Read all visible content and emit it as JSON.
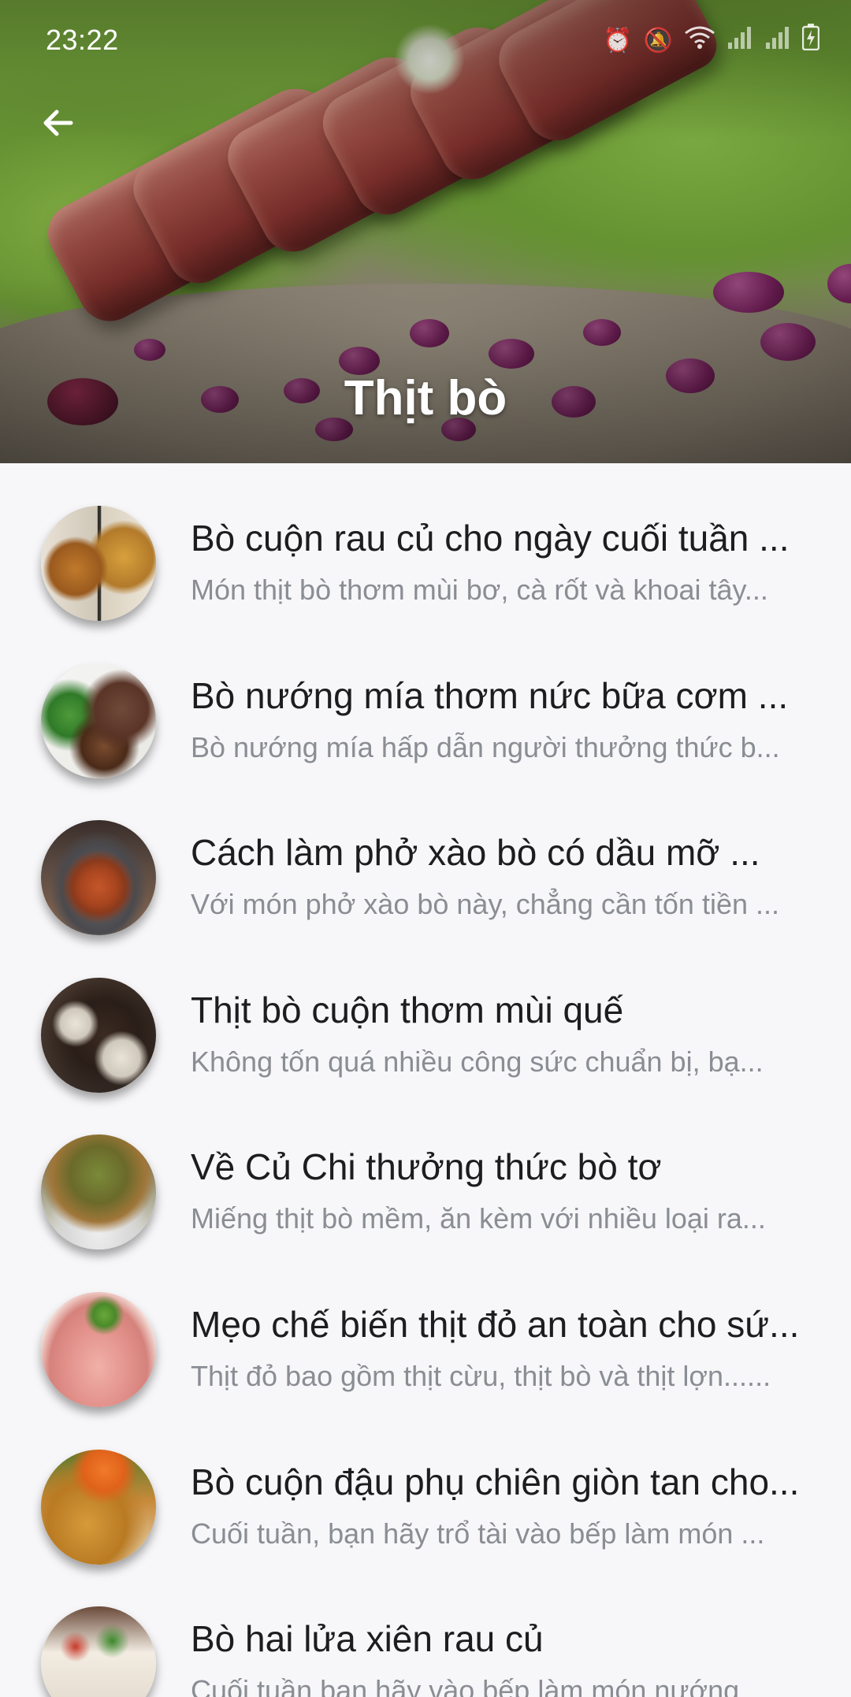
{
  "status_bar": {
    "time": "23:22",
    "icons": [
      "alarm-icon",
      "mute-icon",
      "wifi-icon",
      "signal-icon",
      "signal-icon",
      "battery-charging-icon"
    ]
  },
  "header": {
    "title": "Thịt bò",
    "back_icon": "arrow-left-icon"
  },
  "items": [
    {
      "title": "Bò cuộn rau củ cho ngày cuối tuần ...",
      "description": "Món thịt bò thơm mùi bơ, cà rốt và khoai tây..."
    },
    {
      "title": "Bò nướng mía thơm nức bữa cơm ...",
      "description": "Bò nướng mía hấp dẫn người thưởng thức b..."
    },
    {
      "title": "Cách làm phở xào bò có dầu mỡ ...",
      "description": "Với món phở xào bò này, chẳng cần tốn tiền ..."
    },
    {
      "title": "Thịt bò cuộn thơm mùi quế",
      "description": "Không tốn quá nhiều công sức chuẩn bị, bạ..."
    },
    {
      "title": "Về Củ Chi thưởng thức bò tơ",
      "description": "Miếng thịt bò mềm, ăn kèm với nhiều loại ra..."
    },
    {
      "title": "Mẹo chế biến thịt đỏ an toàn cho sứ...",
      "description": "Thịt đỏ bao gồm thịt cừu, thịt bò và thịt lợn......"
    },
    {
      "title": "Bò cuộn đậu phụ chiên giòn tan cho...",
      "description": "Cuối tuần, bạn hãy trổ tài vào bếp làm món ..."
    },
    {
      "title": "Bò hai lửa xiên rau củ",
      "description": "Cuối tuần bạn hãy vào bếp làm món nướng"
    }
  ]
}
